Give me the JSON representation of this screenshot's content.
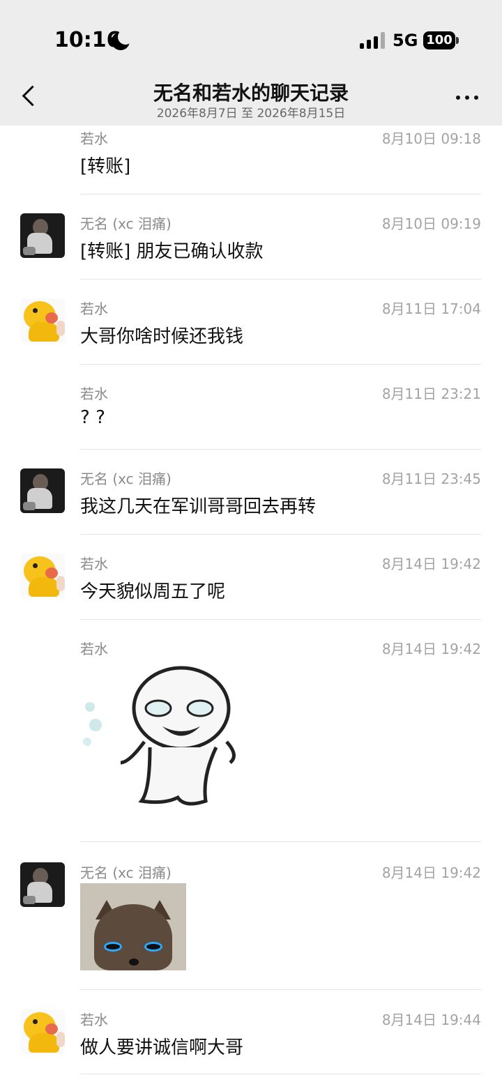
{
  "status_bar": {
    "time": "10:16",
    "network": "5G",
    "battery": "100"
  },
  "header": {
    "title": "无名和若水的聊天记录",
    "subtitle": "2026年8月7日 至 2026年8月15日"
  },
  "messages": [
    {
      "sender": "若水",
      "time": "8月10日 09:18",
      "text": "[转账]"
    },
    {
      "sender": "无名 (xc 泪痛)",
      "time": "8月10日 09:19",
      "text": "[转账] 朋友已确认收款"
    },
    {
      "sender": "若水",
      "time": "8月11日 17:04",
      "text": "大哥你啥时候还我钱"
    },
    {
      "sender": "若水",
      "time": "8月11日 23:21",
      "text": "? ?"
    },
    {
      "sender": "无名 (xc 泪痛)",
      "time": "8月11日 23:45",
      "text": "我这几天在军训哥哥回去再转"
    },
    {
      "sender": "若水",
      "time": "8月14日 19:42",
      "text": "今天貌似周五了呢"
    },
    {
      "sender": "若水",
      "time": "8月14日 19:42",
      "text": ""
    },
    {
      "sender": "无名 (xc 泪痛)",
      "time": "8月14日 19:42",
      "text": ""
    },
    {
      "sender": "若水",
      "time": "8月14日 19:44",
      "text": "做人要讲诚信啊大哥"
    }
  ],
  "colors": {
    "header_bg": "#ededed",
    "name_gray": "#8a8a8a",
    "time_gray": "#a3a3a3",
    "divider": "#e4e4e4"
  }
}
